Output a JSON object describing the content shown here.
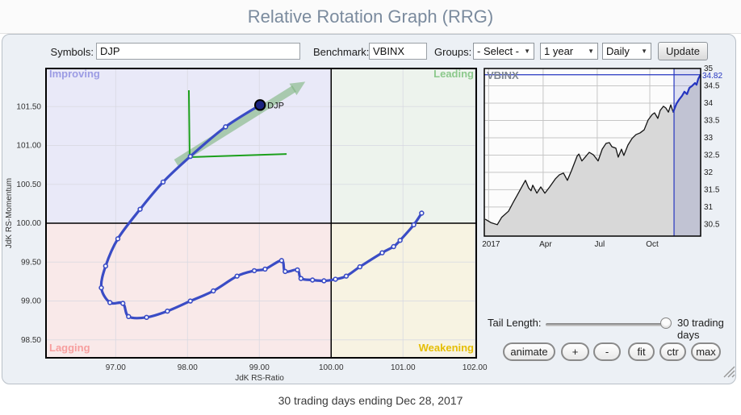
{
  "header": {
    "title": "Relative Rotation Graph (RRG)"
  },
  "toolbar": {
    "symbols_label": "Symbols:",
    "symbols_value": "DJP",
    "benchmark_label": "Benchmark:",
    "benchmark_value": "VBINX",
    "groups_label": "Groups:",
    "groups_selected": "- Select -",
    "period_selected": "1 year",
    "frequency_selected": "Daily",
    "update_label": "Update",
    "dropdown_arrow": "▼"
  },
  "tail_control": {
    "label": "Tail Length:",
    "value": "30 trading days"
  },
  "action_buttons": {
    "animate": "animate",
    "zoom_in": "+",
    "zoom_out": "-",
    "fit": "fit",
    "center": "ctr",
    "max": "max"
  },
  "status_bar": {
    "text": "30 trading days ending Dec 28, 2017"
  },
  "colors": {
    "title": "#7b8b9e",
    "panel_bg": "#ecf0f5",
    "trail_blue": "#3a4cc5",
    "head_navy": "#1b2380",
    "arrow_green": "rgba(125,180,125,0.6)",
    "cross_green": "#1ca01c",
    "highlight_blue": "#2636c0"
  },
  "chart_data": [
    {
      "type": "scatter",
      "title": "",
      "xlabel": "JdK RS-Ratio",
      "ylabel": "JdK RS-Momentum",
      "xlim": [
        96.03,
        102.02
      ],
      "ylim": [
        98.27,
        101.99
      ],
      "xticks": [
        97,
        98,
        99,
        100,
        101,
        102
      ],
      "yticks": [
        98.5,
        99,
        99.5,
        100,
        100.5,
        101,
        101.5
      ],
      "center_x": 100,
      "center_y": 100,
      "grid": true,
      "quadrants": [
        {
          "name": "Improving",
          "position": "top-left",
          "bg": "#e9e9f8",
          "label_color": "#9c9ce4"
        },
        {
          "name": "Leading",
          "position": "top-right",
          "bg": "#edf3ed",
          "label_color": "#8cc98c"
        },
        {
          "name": "Lagging",
          "position": "bottom-left",
          "bg": "#f9e9e9",
          "label_color": "#f79e9e"
        },
        {
          "name": "Weakening",
          "position": "bottom-right",
          "bg": "#f7f3e2",
          "label_color": "#e5be05"
        }
      ],
      "series": [
        {
          "name": "DJP",
          "color": "#3a4cc5",
          "head_color": "#1b2380",
          "points": [
            [
              101.26,
              100.13
            ],
            [
              101.15,
              99.98
            ],
            [
              100.96,
              99.78
            ],
            [
              100.87,
              99.7
            ],
            [
              100.71,
              99.62
            ],
            [
              100.4,
              99.44
            ],
            [
              100.21,
              99.32
            ],
            [
              100.06,
              99.28
            ],
            [
              99.9,
              99.26
            ],
            [
              99.74,
              99.27
            ],
            [
              99.58,
              99.29
            ],
            [
              99.53,
              99.4
            ],
            [
              99.36,
              99.38
            ],
            [
              99.31,
              99.52
            ],
            [
              99.08,
              99.41
            ],
            [
              98.93,
              99.39
            ],
            [
              98.69,
              99.32
            ],
            [
              98.36,
              99.13
            ],
            [
              98.04,
              99.0
            ],
            [
              97.72,
              98.87
            ],
            [
              97.43,
              98.79
            ],
            [
              97.18,
              98.8
            ],
            [
              97.1,
              98.97
            ],
            [
              96.92,
              98.98
            ],
            [
              96.8,
              99.17
            ],
            [
              96.86,
              99.45
            ],
            [
              97.03,
              99.8
            ],
            [
              97.34,
              100.18
            ],
            [
              97.66,
              100.53
            ],
            [
              98.04,
              100.86
            ],
            [
              98.53,
              101.24
            ],
            [
              99.01,
              101.52
            ]
          ]
        }
      ],
      "annotations": {
        "arrow": {
          "from": [
            97.84,
            100.78
          ],
          "to": [
            99.64,
            101.82
          ],
          "color": "rgba(125,180,125,0.6)"
        },
        "cross": {
          "center": [
            98.03,
            100.85
          ],
          "v_top": 101.71,
          "h_end": [
            99.38,
            100.89
          ],
          "color": "#1ca01c"
        }
      }
    },
    {
      "type": "area",
      "title": "VBINX",
      "ylim": [
        30.16,
        35.0
      ],
      "yticks": [
        30.5,
        31,
        31.5,
        32,
        32.5,
        33,
        33.5,
        34,
        34.5,
        35
      ],
      "x_axis_labels": [
        {
          "label": "2017",
          "frac": 0.02
        },
        {
          "label": "Apr",
          "frac": 0.272
        },
        {
          "label": "Jul",
          "frac": 0.522
        },
        {
          "label": "Oct",
          "frac": 0.765
        }
      ],
      "line_color": "#141414",
      "fill_color": "#d8d8d8",
      "highlight": {
        "start_frac": 0.877,
        "line_color": "#2636c0",
        "fill_color": "rgba(90,100,190,0.18)"
      },
      "last_price": 34.82,
      "last_price_label": "34.82",
      "points": [
        [
          0.004,
          30.65
        ],
        [
          0.03,
          30.55
        ],
        [
          0.06,
          30.49
        ],
        [
          0.08,
          30.7
        ],
        [
          0.112,
          30.88
        ],
        [
          0.135,
          31.15
        ],
        [
          0.153,
          31.35
        ],
        [
          0.175,
          31.6
        ],
        [
          0.19,
          31.77
        ],
        [
          0.205,
          31.55
        ],
        [
          0.216,
          31.47
        ],
        [
          0.224,
          31.63
        ],
        [
          0.243,
          31.4
        ],
        [
          0.261,
          31.58
        ],
        [
          0.28,
          31.4
        ],
        [
          0.302,
          31.58
        ],
        [
          0.328,
          31.81
        ],
        [
          0.347,
          31.93
        ],
        [
          0.366,
          31.98
        ],
        [
          0.384,
          31.77
        ],
        [
          0.403,
          32.05
        ],
        [
          0.429,
          32.47
        ],
        [
          0.437,
          32.53
        ],
        [
          0.451,
          32.33
        ],
        [
          0.466,
          32.44
        ],
        [
          0.485,
          32.58
        ],
        [
          0.504,
          32.51
        ],
        [
          0.526,
          32.33
        ],
        [
          0.545,
          32.67
        ],
        [
          0.563,
          32.84
        ],
        [
          0.578,
          32.86
        ],
        [
          0.59,
          32.74
        ],
        [
          0.608,
          32.7
        ],
        [
          0.619,
          32.44
        ],
        [
          0.634,
          32.67
        ],
        [
          0.645,
          32.49
        ],
        [
          0.664,
          32.79
        ],
        [
          0.683,
          32.98
        ],
        [
          0.701,
          33.09
        ],
        [
          0.72,
          33.14
        ],
        [
          0.739,
          33.23
        ],
        [
          0.757,
          33.51
        ],
        [
          0.776,
          33.67
        ],
        [
          0.787,
          33.72
        ],
        [
          0.802,
          33.56
        ],
        [
          0.813,
          33.79
        ],
        [
          0.828,
          33.91
        ],
        [
          0.839,
          33.86
        ],
        [
          0.851,
          33.74
        ],
        [
          0.862,
          33.95
        ],
        [
          0.873,
          33.74
        ],
        [
          0.888,
          33.98
        ],
        [
          0.899,
          34.09
        ],
        [
          0.914,
          34.21
        ],
        [
          0.925,
          34.33
        ],
        [
          0.937,
          34.26
        ],
        [
          0.948,
          34.44
        ],
        [
          0.959,
          34.49
        ],
        [
          0.974,
          34.58
        ],
        [
          0.981,
          34.53
        ],
        [
          0.989,
          34.7
        ],
        [
          0.996,
          34.78
        ],
        [
          1.0,
          34.82
        ]
      ]
    }
  ]
}
